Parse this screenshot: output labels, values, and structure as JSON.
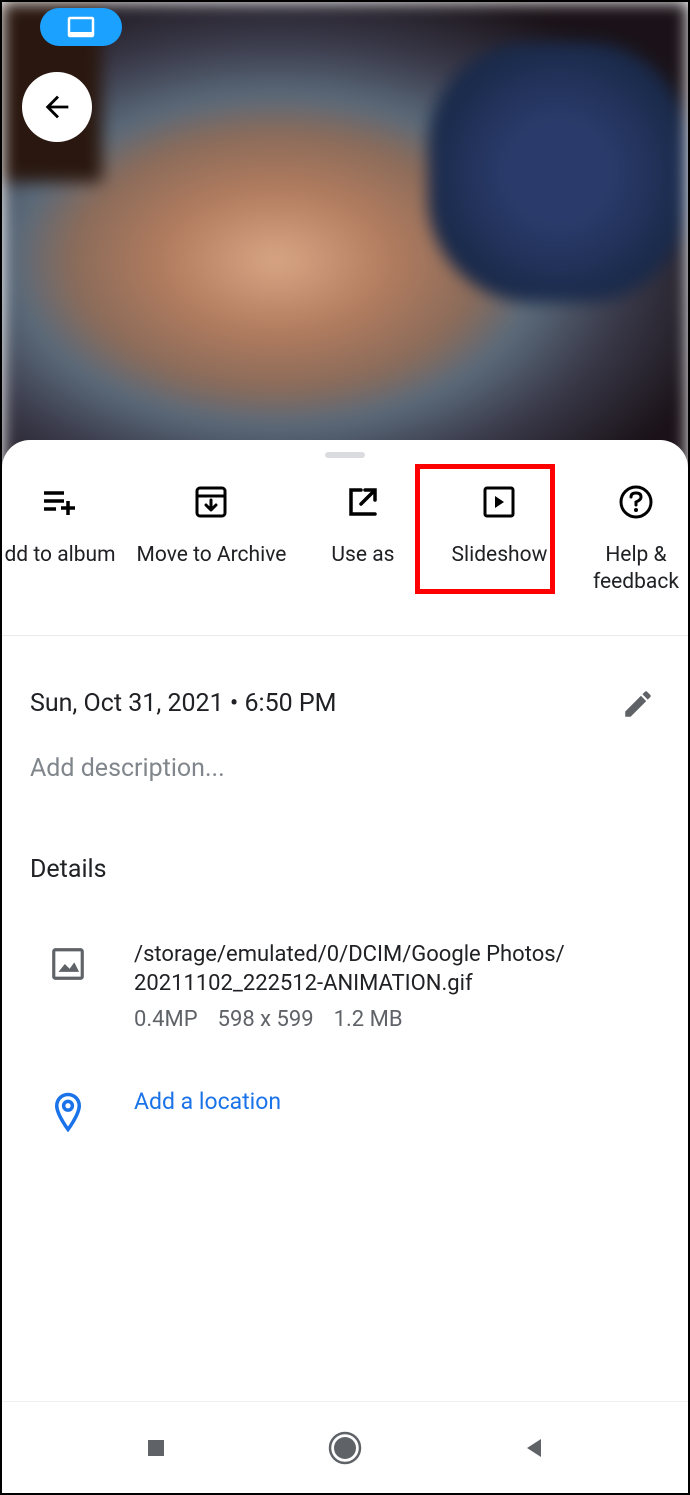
{
  "actions": {
    "add_to_album": "dd to album",
    "move_to_archive": "Move to Archive",
    "use_as": "Use as",
    "slideshow": "Slideshow",
    "help_feedback": "Help &\nfeedback"
  },
  "datetime": "Sun, Oct 31, 2021  •  6:50 PM",
  "description_placeholder": "Add description...",
  "details_header": "Details",
  "file": {
    "path_line1": "/storage/emulated/0/DCIM/Google Photos/",
    "path_line2": "20211102_222512-ANIMATION.gif",
    "megapixels": "0.4MP",
    "dimensions": "598 x 599",
    "size": "1.2 MB"
  },
  "location_link": "Add a location"
}
